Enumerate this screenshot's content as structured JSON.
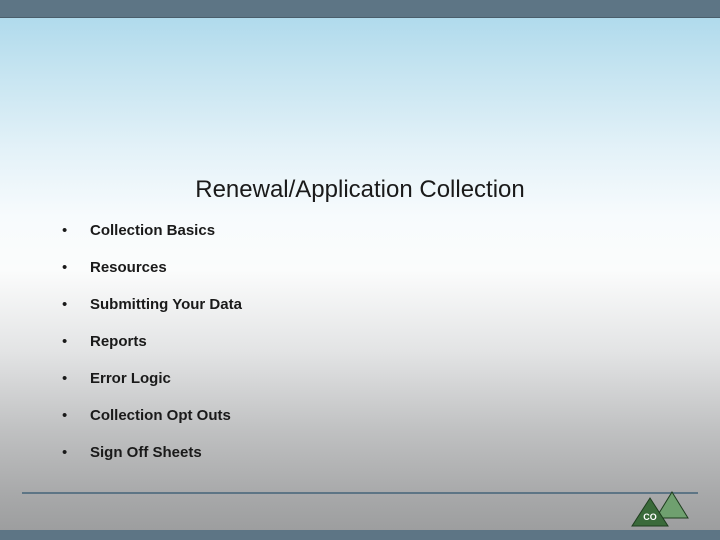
{
  "title": "Renewal/Application Collection",
  "bullets": [
    "Collection Basics",
    "Resources",
    "Submitting Your Data",
    "Reports",
    "Error Logic",
    "Collection Opt Outs",
    "Sign Off Sheets"
  ],
  "logo": {
    "text": "CO",
    "alt": "cde-co-logo"
  },
  "colors": {
    "bar": "#5d7585",
    "triangle_fill": "#3a6a3a",
    "triangle_stroke": "#1e3d1e"
  }
}
